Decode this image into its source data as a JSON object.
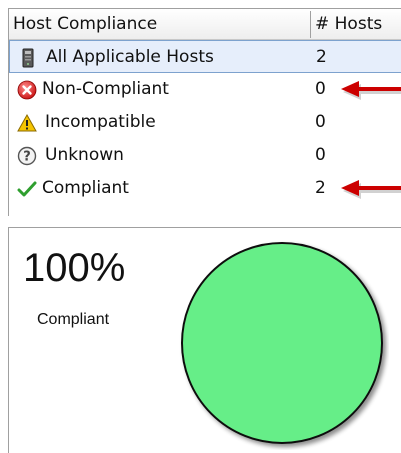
{
  "table": {
    "columns": [
      "Host Compliance",
      "# Hosts"
    ],
    "rows": [
      {
        "label": "All Applicable Hosts",
        "count": "2",
        "icon": "host-server-icon"
      },
      {
        "label": "Non-Compliant",
        "count": "0",
        "icon": "red-x-circle-icon"
      },
      {
        "label": "Incompatible",
        "count": "0",
        "icon": "warning-triangle-icon"
      },
      {
        "label": "Unknown",
        "count": "0",
        "icon": "question-circle-icon"
      },
      {
        "label": "Compliant",
        "count": "2",
        "icon": "green-check-icon"
      }
    ],
    "selected_row": 0
  },
  "summary": {
    "percent": "100%",
    "label": "Compliant"
  },
  "chart_data": {
    "type": "pie",
    "categories": [
      "Compliant"
    ],
    "values": [
      100
    ]
  },
  "colors": {
    "pie_fill": "#66ee88",
    "arrow": "#cc0000",
    "selection_bg": "#e6eefb",
    "selection_border": "#7da2ce"
  }
}
